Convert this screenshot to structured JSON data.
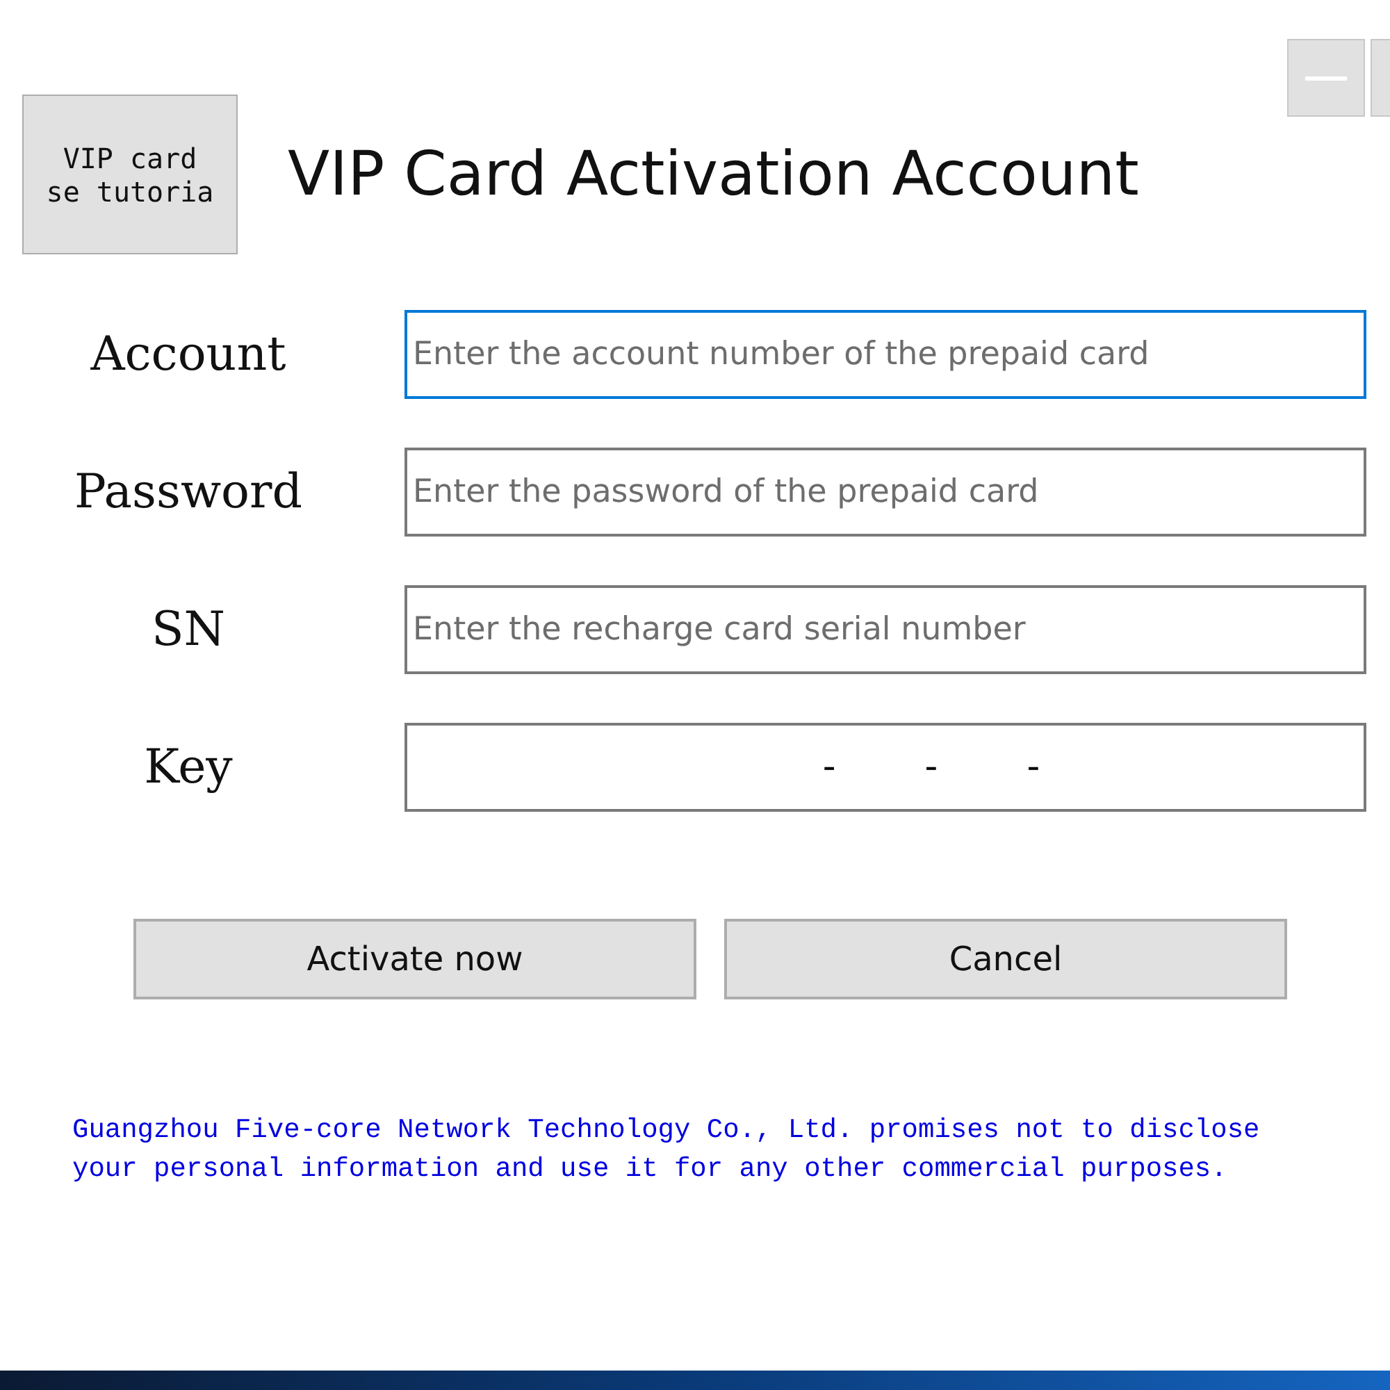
{
  "tutorial_button": {
    "lines": [
      "VIP card",
      "se tutoria"
    ]
  },
  "title": "VIP Card Activation Account",
  "fields": [
    {
      "label": "Account",
      "kind": "text",
      "placeholder": "Enter the account number of the prepaid card",
      "focused": true
    },
    {
      "label": "Password",
      "kind": "text",
      "placeholder": "Enter the password of the prepaid card",
      "focused": false
    },
    {
      "label": "SN",
      "kind": "text",
      "placeholder": "Enter the recharge card serial number",
      "focused": false
    },
    {
      "label": "Key",
      "kind": "masked",
      "separators": [
        "-",
        "-",
        "-"
      ],
      "focused": false
    }
  ],
  "buttons": [
    "Activate now",
    "Cancel"
  ],
  "notice": "Guangzhou Five-core Network Technology Co., Ltd. promises not to disclose your personal information and use it for any other commercial purposes."
}
